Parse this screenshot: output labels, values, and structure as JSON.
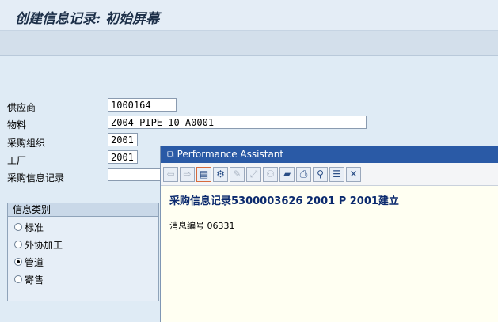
{
  "header": {
    "title": "创建信息记录: 初始屏幕"
  },
  "form": {
    "vendor": {
      "label": "供应商",
      "value": "1000164"
    },
    "material": {
      "label": "物料",
      "value": "Z004-PIPE-10-A0001"
    },
    "purch_org": {
      "label": "采购组织",
      "value": "2001"
    },
    "plant": {
      "label": "工厂",
      "value": "2001"
    },
    "info_record": {
      "label": "采购信息记录",
      "value": ""
    }
  },
  "info_category": {
    "title": "信息类别",
    "options": [
      {
        "label": "标准",
        "selected": false
      },
      {
        "label": "外协加工",
        "selected": false
      },
      {
        "label": "管道",
        "selected": true
      },
      {
        "label": "寄售",
        "selected": false
      }
    ]
  },
  "assistant": {
    "title": "Performance Assistant",
    "message": "采购信息记录5300003626 2001 P 2001建立",
    "message_number": "消息编号 06331",
    "toolbar_icons": [
      "back-arrow-icon",
      "forward-arrow-icon",
      "document-icon",
      "technical-info-icon",
      "edit-icon",
      "link-icon",
      "glasses-icon",
      "bookmark-icon",
      "print-icon",
      "search-icon",
      "settings-icon",
      "close-icon"
    ]
  }
}
